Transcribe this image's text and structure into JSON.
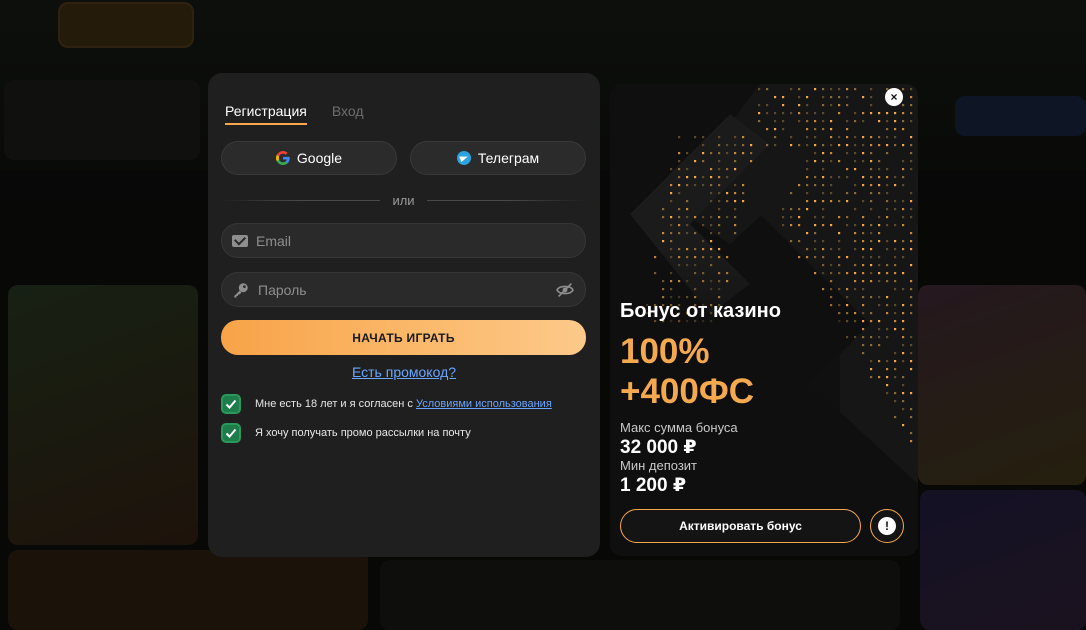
{
  "tabs": {
    "register": "Регистрация",
    "login": "Вход"
  },
  "social": {
    "google": "Google",
    "telegram": "Телеграм"
  },
  "divider": "или",
  "form": {
    "email_placeholder": "Email",
    "password_placeholder": "Пароль",
    "submit": "НАЧАТЬ ИГРАТЬ",
    "promo_link": "Есть промокод?"
  },
  "consent": {
    "age_text": "Мне есть 18 лет и я согласен с ",
    "terms_link": "Условиями использования",
    "promo_text": "Я хочу получать промо рассылки на почту",
    "age_checked": true,
    "promo_checked": true
  },
  "bonus": {
    "title": "Бонус от казино",
    "line1": "100%",
    "line2": "+400ФС",
    "max_label": "Макс сумма бонуса",
    "max_value": "32 000 ₽",
    "min_label": "Мин депозит",
    "min_value": "1 200 ₽",
    "activate": "Активировать бонус",
    "close": "×",
    "info": "!"
  },
  "colors": {
    "accent": "#f5a94e",
    "link": "#6aa6ff",
    "check": "#1e7d4b",
    "panel": "#1f1f1f"
  },
  "icons": [
    "google-icon",
    "telegram-icon",
    "mail-icon",
    "key-icon",
    "eye-off-icon",
    "check-icon",
    "close-icon",
    "info-icon"
  ]
}
